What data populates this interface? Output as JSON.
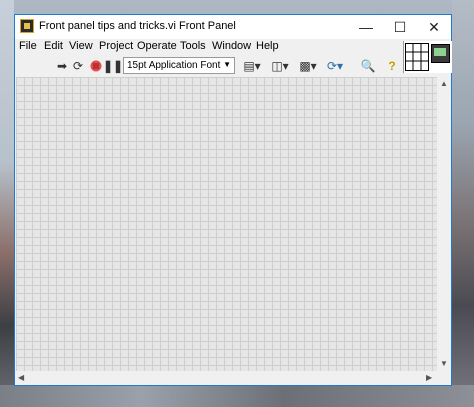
{
  "window": {
    "title": "Front panel tips and tricks.vi Front Panel"
  },
  "menus": [
    "File",
    "Edit",
    "View",
    "Project",
    "Operate",
    "Tools",
    "Window",
    "Help"
  ],
  "toolbar": {
    "font": "15pt Application Font"
  },
  "colors": {
    "window_border": "#1f7ad1",
    "grid_background": "#e6e6e6",
    "grid_line": "#cfcfcf",
    "abort_button": "#e05050"
  }
}
